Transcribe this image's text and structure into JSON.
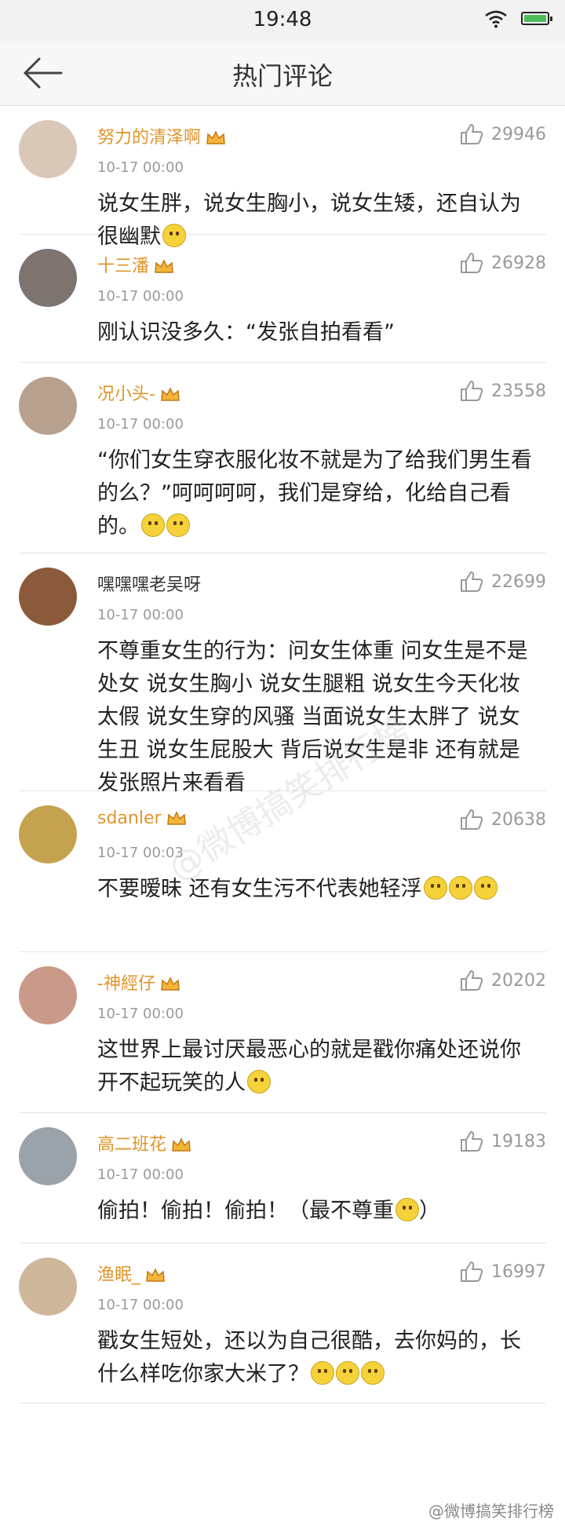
{
  "status_bar": {
    "time": "19:48"
  },
  "header": {
    "title": "热门评论"
  },
  "comments": [
    {
      "name": "努力的清泽啊",
      "vip": true,
      "time": "10-17 00:00",
      "likes": "29946",
      "text": "说女生胖，说女生胸小，说女生矮，还自认为很幽默",
      "emojis": 1,
      "avatar_color": "#d9c7b8"
    },
    {
      "name": "十三潘",
      "vip": true,
      "time": "10-17 00:00",
      "likes": "26928",
      "text": "刚认识没多久：“发张自拍看看”",
      "emojis": 0,
      "avatar_color": "#7d7470"
    },
    {
      "name": "况小头-",
      "vip": true,
      "time": "10-17 00:00",
      "likes": "23558",
      "text": "“你们女生穿衣服化妆不就是为了给我们男生看的么？”呵呵呵呵，我们是穿给，化给自己看的。",
      "emojis": 2,
      "avatar_color": "#b8a08e"
    },
    {
      "name": "嘿嘿嘿老吴呀",
      "vip": false,
      "time": "10-17 00:00",
      "likes": "22699",
      "text": "不尊重女生的行为：问女生体重 问女生是不是处女 说女生胸小 说女生腿粗 说女生今天化妆太假 说女生穿的风骚 当面说女生太胖了 说女生丑 说女生屁股大 背后说女生是非 还有就是发张照片来看看",
      "emojis": 0,
      "avatar_color": "#8a5a3a"
    },
    {
      "name": "sdanler",
      "vip": true,
      "time": "10-17 00:03",
      "likes": "20638",
      "text": "不要暧昧  还有女生污不代表她轻浮",
      "emojis": 3,
      "avatar_color": "#c5a24e"
    },
    {
      "name": "-神經仔",
      "vip": true,
      "time": "10-17 00:00",
      "likes": "20202",
      "text": "这世界上最讨厌最恶心的就是戳你痛处还说你开不起玩笑的人",
      "emojis": 1,
      "avatar_color": "#c99a8a"
    },
    {
      "name": "高二班花",
      "vip": true,
      "time": "10-17 00:00",
      "likes": "19183",
      "text": "偷拍！偷拍！偷拍！（最不尊重",
      "text_tail": "）",
      "emojis": 1,
      "avatar_color": "#9aa2aa"
    },
    {
      "name": "渔眠_",
      "vip": true,
      "time": "10-17 00:00",
      "likes": "16997",
      "text": "戳女生短处，还以为自己很酷，去你妈的，长什么样吃你家大米了？",
      "emojis": 3,
      "avatar_color": "#cfb79c"
    }
  ],
  "watermark": "@微博搞笑排行榜",
  "corner_mark": "@微博搞笑排行榜"
}
